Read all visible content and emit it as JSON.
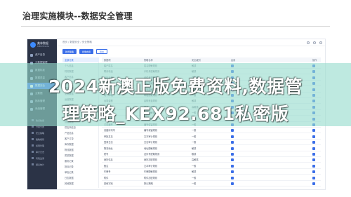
{
  "page_heading": "治理实施模块--数据安全管理",
  "app": {
    "logo_name": "美林数据",
    "logo_sub": "MERITDATA"
  },
  "sidebar": {
    "items": [
      {
        "label": "资产目录"
      },
      {
        "label": "元数据管理"
      },
      {
        "label": "数据标准"
      },
      {
        "label": "数据质量"
      },
      {
        "label": "数据安全"
      },
      {
        "label": "主数据"
      },
      {
        "label": "指标管理"
      },
      {
        "label": "系统管理"
      }
    ],
    "sub_items": [
      {
        "label": "敏感数据"
      },
      {
        "label": "分级分类"
      },
      {
        "label": "安全策略"
      },
      {
        "label": "脱敏规则"
      },
      {
        "label": "权限管理"
      },
      {
        "label": "审计日志"
      },
      {
        "label": "风险监测"
      },
      {
        "label": "报表统计"
      }
    ]
  },
  "topbar": {
    "breadcrumb": "首页 / 数据安全 / 安全策略"
  },
  "toolbar": {
    "buttons": [
      {
        "label": "新增策略"
      },
      {
        "label": "批量启用"
      },
      {
        "label": "导出"
      }
    ]
  },
  "tree": {
    "items": [
      {
        "label": "全部分类"
      },
      {
        "label": "个人信息"
      },
      {
        "label": "财务数据"
      },
      {
        "label": "客户信息"
      },
      {
        "label": "合同数据"
      },
      {
        "label": "员工档案"
      },
      {
        "label": "业务数据"
      },
      {
        "label": "运营数据"
      },
      {
        "label": "采购数据"
      },
      {
        "label": "销售数据"
      },
      {
        "label": "生产数据"
      },
      {
        "label": "设备数据"
      },
      {
        "label": "供应商信息"
      },
      {
        "label": "产品信息"
      },
      {
        "label": "客户订单"
      },
      {
        "label": "库存数据"
      },
      {
        "label": "物流数据"
      },
      {
        "label": "质量数据"
      },
      {
        "label": "服务记录"
      },
      {
        "label": "投诉记录"
      },
      {
        "label": "审批记录"
      },
      {
        "label": "日志数据"
      },
      {
        "label": "其他数据"
      }
    ]
  },
  "table": {
    "headers": [
      "数据项",
      "策略名称",
      "安全级别",
      "启用",
      "操作"
    ],
    "rows": [
      {
        "item": "客户姓名",
        "policy": "姓名脱敏规则",
        "level": "敏感",
        "enabled": true
      },
      {
        "item": "联系电话",
        "policy": "手机号脱敏规则",
        "level": "敏感",
        "enabled": true
      },
      {
        "item": "身份证号",
        "policy": "证件号脱敏规则",
        "level": "高敏感",
        "enabled": true
      },
      {
        "item": "家庭住址",
        "policy": "地址脱敏规则",
        "level": "敏感",
        "enabled": true
      },
      {
        "item": "银行账号",
        "policy": "账号脱敏规则",
        "level": "高敏感",
        "enabled": true
      },
      {
        "item": "电子邮箱",
        "policy": "邮箱脱敏规则",
        "level": "一般",
        "enabled": true
      },
      {
        "item": "合同金额",
        "policy": "金额遮盖规则",
        "level": "敏感",
        "enabled": true
      },
      {
        "item": "员工薪资",
        "policy": "薪资加密规则",
        "level": "高敏感",
        "enabled": true
      },
      {
        "item": "出生日期",
        "policy": "日期脱敏规则",
        "level": "一般",
        "enabled": true
      },
      {
        "item": "供应商账户",
        "policy": "账号脱敏规则",
        "level": "敏感",
        "enabled": true
      },
      {
        "item": "订单编号",
        "policy": "编号保留规则",
        "level": "一般",
        "enabled": true
      },
      {
        "item": "设备序列号",
        "policy": "编号保留规则",
        "level": "一般",
        "enabled": true
      },
      {
        "item": "审批意见",
        "policy": "文本审计规则",
        "level": "一般",
        "enabled": true
      },
      {
        "item": "登录日志",
        "policy": "日志审计规则",
        "level": "一般",
        "enabled": true
      },
      {
        "item": "物流地址",
        "policy": "地址脱敏规则",
        "level": "敏感",
        "enabled": true
      },
      {
        "item": "税号",
        "policy": "证件号脱敏规则",
        "level": "敏感",
        "enabled": true
      },
      {
        "item": "病历信息",
        "policy": "病历加密规则",
        "level": "高敏感",
        "enabled": true
      },
      {
        "item": "备注",
        "policy": "文本审计规则",
        "level": "一般",
        "enabled": true
      },
      {
        "item": "车牌号",
        "policy": "车牌脱敏规则",
        "level": "敏感",
        "enabled": true
      },
      {
        "item": "附件",
        "policy": "附件加密规则",
        "level": "一般",
        "enabled": true
      },
      {
        "item": "其他字段",
        "policy": "默认策略",
        "level": "一般",
        "enabled": true
      }
    ]
  },
  "watermark": {
    "line1": "2024新澳正版免费资料,数据管",
    "line2": "理策略_KEX92.681私密版"
  },
  "colors": {
    "accent": "#3a6ee8",
    "sidebar_bg": "#2b3346",
    "watermark_band": "#96dccd"
  }
}
